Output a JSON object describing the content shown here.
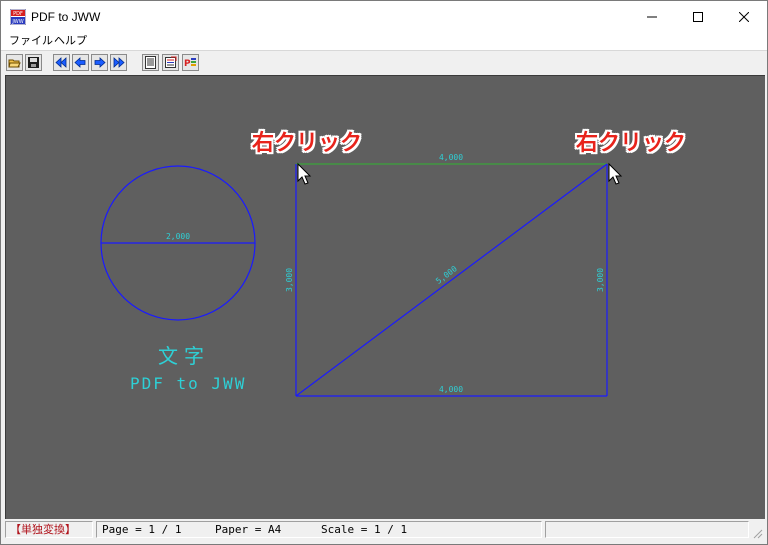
{
  "window": {
    "title": "PDF to JWW",
    "icon": "pdf-to-jww-app-icon"
  },
  "window_controls": {
    "minimize_icon": "minimize-icon",
    "maximize_icon": "maximize-icon",
    "close_icon": "close-icon"
  },
  "menu": {
    "items": [
      {
        "label": "ファイル"
      },
      {
        "label": "ヘルプ"
      }
    ]
  },
  "toolbar": {
    "buttons": [
      {
        "icon": "open-folder-icon"
      },
      {
        "icon": "save-icon"
      },
      {
        "icon": "first-page-icon"
      },
      {
        "icon": "previous-page-icon"
      },
      {
        "icon": "next-page-icon"
      },
      {
        "icon": "last-page-icon"
      },
      {
        "icon": "document-list-icon"
      },
      {
        "icon": "convert-settings-icon"
      },
      {
        "icon": "pdf-export-icon"
      }
    ]
  },
  "drawing": {
    "callout_left": "右クリック",
    "callout_right": "右クリック",
    "circle_dimension": "2,000",
    "top_dimension": "4,000",
    "bottom_dimension": "4,000",
    "left_dimension": "3,000",
    "right_dimension": "3,000",
    "diagonal_dimension": "5,000",
    "text_moji": "文字",
    "text_pdf": "PDF to JWW",
    "colors": {
      "background": "#5f5f5f",
      "line": "#1a1aff",
      "dimension": "#2ed0d6",
      "top_line": "#3aa53a",
      "callout": "#e8231b"
    }
  },
  "status": {
    "mode": "【単独変換】",
    "page": "Page = 1 / 1",
    "paper": "Paper = A4",
    "scale": "Scale = 1 / 1"
  }
}
